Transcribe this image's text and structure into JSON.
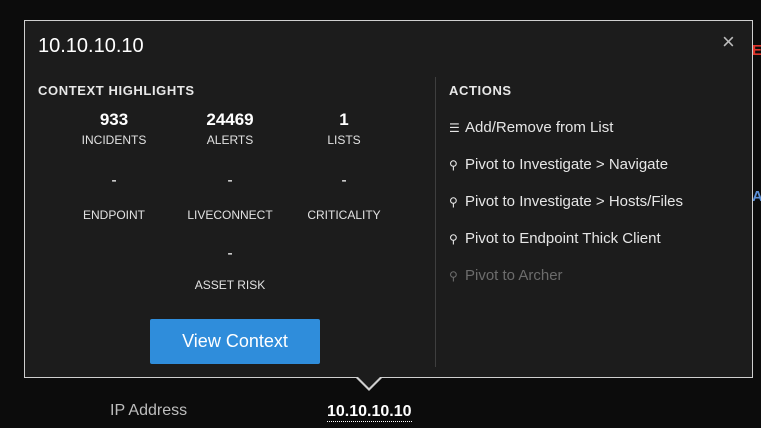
{
  "popup": {
    "title": "10.10.10.10",
    "close_glyph": "×"
  },
  "context": {
    "heading": "CONTEXT HIGHLIGHTS",
    "stats": [
      {
        "value": "933",
        "label": "INCIDENTS"
      },
      {
        "value": "24469",
        "label": "ALERTS"
      },
      {
        "value": "1",
        "label": "LISTS"
      },
      {
        "value": "-",
        "label": "ENDPOINT"
      },
      {
        "value": "-",
        "label": "LIVECONNECT"
      },
      {
        "value": "-",
        "label": "CRITICALITY"
      },
      {
        "value": "-",
        "label": "ASSET RISK"
      }
    ],
    "view_button": "View Context"
  },
  "actions": {
    "heading": "ACTIONS",
    "items": [
      {
        "icon": "list-icon",
        "glyph": "☰",
        "label": "Add/Remove from List",
        "enabled": true
      },
      {
        "icon": "search-icon",
        "glyph": "⚲",
        "label": "Pivot to Investigate > Navigate",
        "enabled": true
      },
      {
        "icon": "search-icon",
        "glyph": "⚲",
        "label": "Pivot to Investigate > Hosts/Files",
        "enabled": true
      },
      {
        "icon": "search-icon",
        "glyph": "⚲",
        "label": "Pivot to Endpoint Thick Client",
        "enabled": true
      },
      {
        "icon": "search-icon",
        "glyph": "⚲",
        "label": "Pivot to Archer",
        "enabled": false
      }
    ]
  },
  "footer": {
    "label": "IP Address",
    "value": "10.10.10.10"
  },
  "colors": {
    "accent": "#2f8ddb",
    "panel_bg": "#1c1c1c",
    "page_bg": "#0c0c0c",
    "disabled_text": "#6c6c6c"
  }
}
